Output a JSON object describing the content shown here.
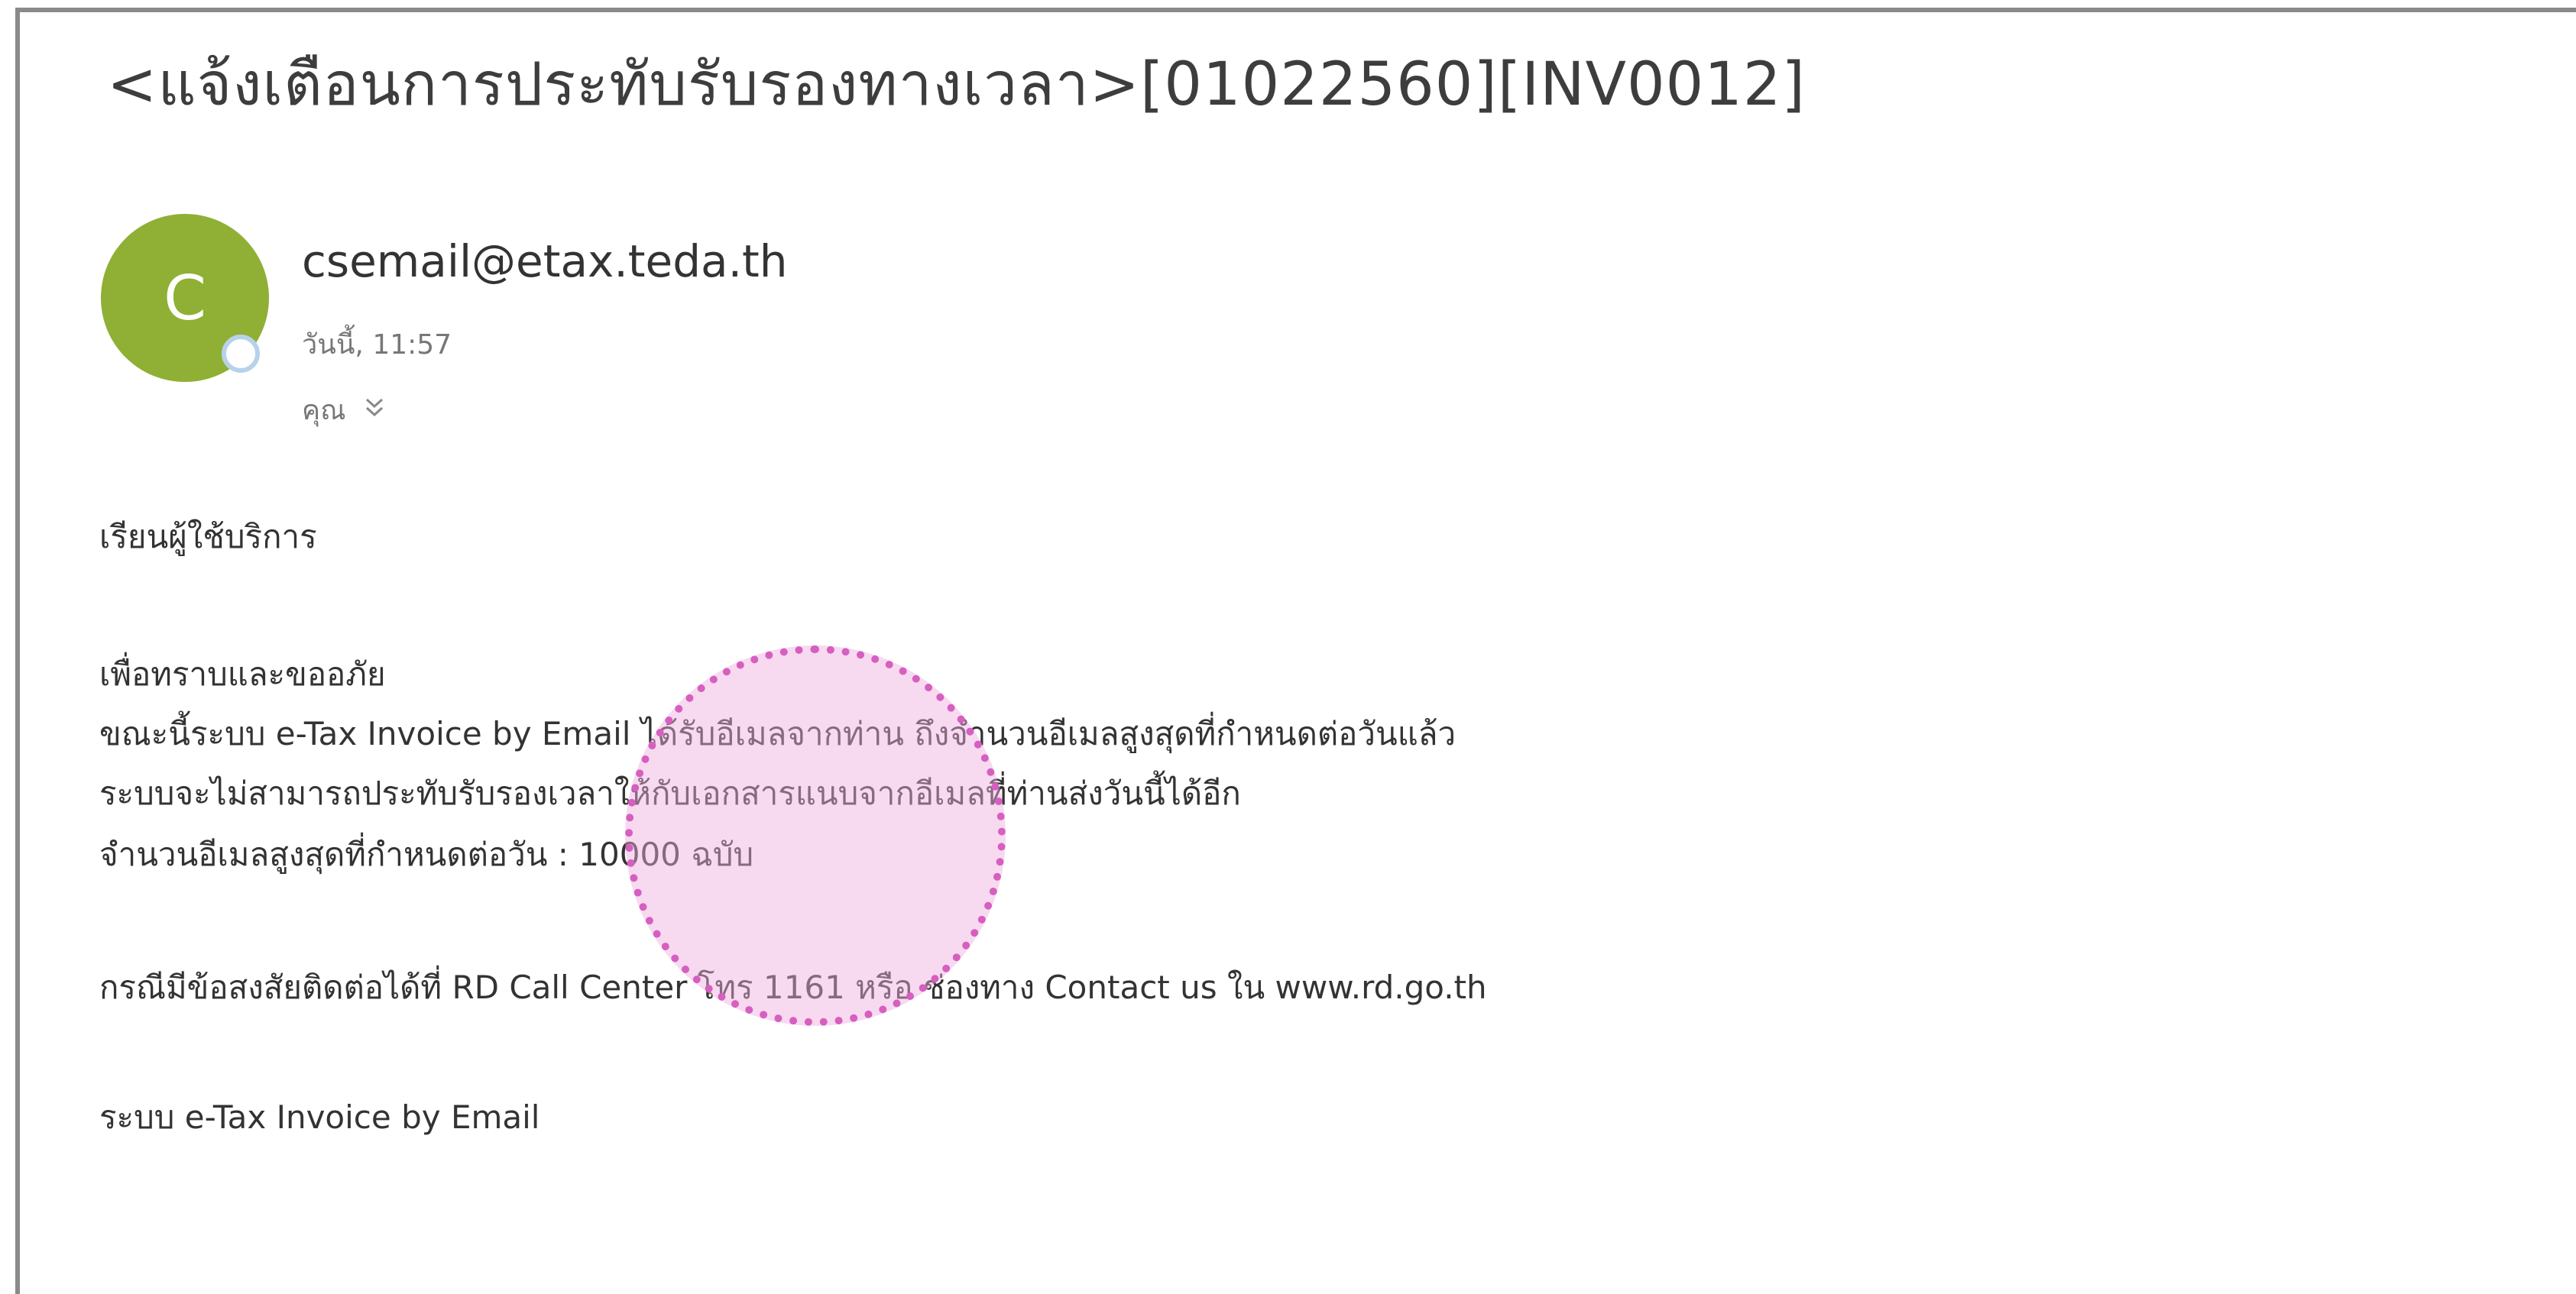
{
  "email": {
    "subject": "<แจ้งเตือนการประทับรับรองทางเวลา>[01022560][INV0012]",
    "sender": {
      "initial": "C",
      "address": "csemail@etax.teda.th",
      "time": "วันนี้, 11:57",
      "recipient": "คุณ",
      "recipient_toggle_icon": "chevron-down-icon",
      "avatar_color": "#8fb034"
    },
    "body": {
      "greeting": "เรียนผู้ใช้บริการ",
      "line1": "เพื่อทราบและขออภัย",
      "line2": "ขณะนี้ระบบ e-Tax Invoice by Email ได้รับอีเมลจากท่าน ถึงจำนวนอีเมลสูงสุดที่กำหนดต่อวันแล้ว",
      "line3": "ระบบจะไม่สามารถประทับรับรองเวลาให้กับเอกสารแนบจากอีเมลที่ท่านส่งวันนี้ได้อีก",
      "line4": "จำนวนอีเมลสูงสุดที่กำหนดต่อวัน : 10000 ฉบับ",
      "contact": "กรณีมีข้อสงสัยติดต่อได้ที่ RD Call Center โทร 1161 หรือ ช่องทาง Contact us ใน www.rd.go.th",
      "signature": "ระบบ e-Tax Invoice by Email"
    },
    "highlight_color": "#d65fc0"
  }
}
